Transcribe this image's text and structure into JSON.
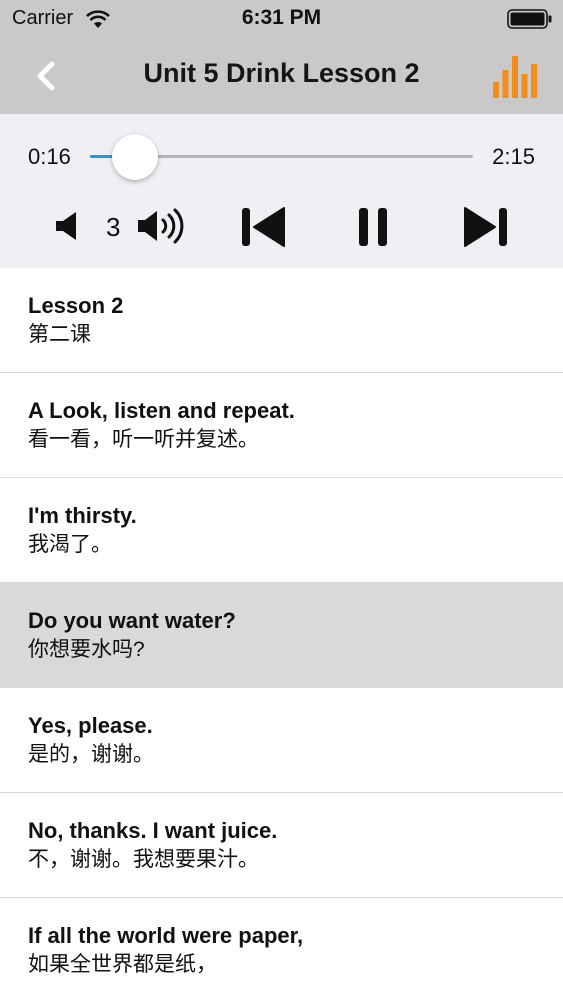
{
  "status_bar": {
    "carrier": "Carrier",
    "time": "6:31 PM"
  },
  "nav": {
    "title": "Unit 5 Drink Lesson 2",
    "back_icon": "chevron-left-icon",
    "chart_icon": "bar-chart-icon",
    "accent_color": "#f28c1a"
  },
  "player": {
    "current_time": "0:16",
    "total_time": "2:15",
    "progress": 0.1185,
    "volume_level": "3",
    "slider_color": "#1e9be0"
  },
  "lesson_items": [
    {
      "en": "Lesson 2",
      "zh": "第二课",
      "selected": false
    },
    {
      "en": "A Look, listen and repeat.",
      "zh": "看一看，听一听并复述。",
      "selected": false
    },
    {
      "en": "I'm thirsty.",
      "zh": "我渴了。",
      "selected": false
    },
    {
      "en": "Do you want water?",
      "zh": "你想要水吗?",
      "selected": true
    },
    {
      "en": "Yes, please.",
      "zh": "是的，谢谢。",
      "selected": false
    },
    {
      "en": "No, thanks. I want juice.",
      "zh": "不，谢谢。我想要果汁。",
      "selected": false
    },
    {
      "en": "If all the world were paper,",
      "zh": "如果全世界都是纸，",
      "selected": false
    }
  ]
}
